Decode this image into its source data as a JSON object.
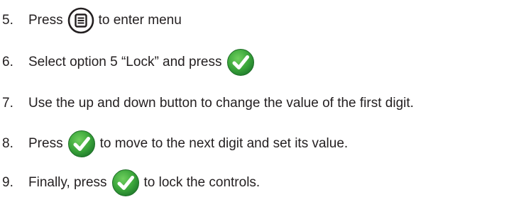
{
  "steps": [
    {
      "number": "5.",
      "before": "Press",
      "icon": "menu-button-icon",
      "after": "to enter menu"
    },
    {
      "number": "6.",
      "before": "Select option 5 “Lock” and press",
      "icon": "green-check-button-icon",
      "after": ""
    },
    {
      "number": "7.",
      "before": "Use the up and down button to change the value of the first digit.",
      "icon": "",
      "after": ""
    },
    {
      "number": "8.",
      "before": "Press",
      "icon": "green-check-button-icon",
      "after": "to move to the next digit and set its value."
    },
    {
      "number": "9.",
      "before": "Finally, press",
      "icon": "green-check-button-icon",
      "after": "to lock the controls."
    }
  ],
  "colors": {
    "text": "#231f20",
    "check_green": "#3aa53a",
    "check_green_dark": "#1f7a2c"
  }
}
